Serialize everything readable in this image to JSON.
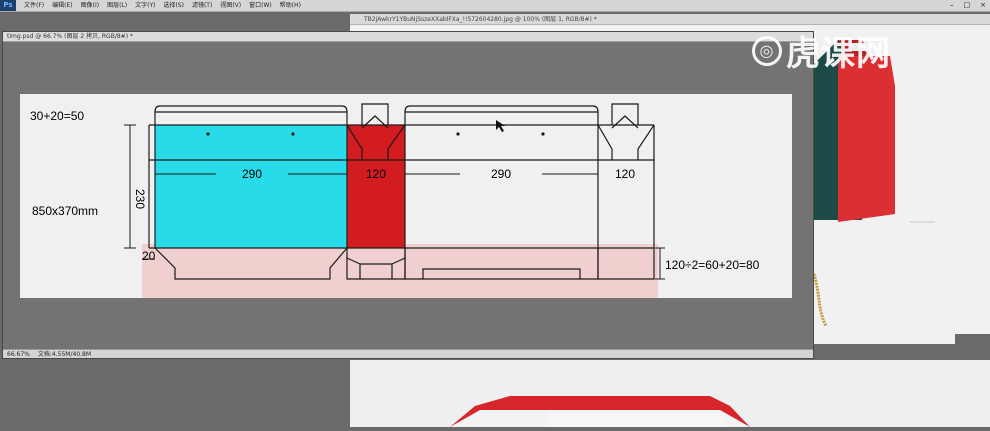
{
  "app": {
    "logo": "Ps",
    "menus": [
      "文件(F)",
      "编辑(E)",
      "图像(I)",
      "图层(L)",
      "文字(Y)",
      "选择(S)",
      "滤镜(T)",
      "视图(V)",
      "窗口(W)",
      "帮助(H)"
    ],
    "window_controls": [
      "–",
      "□",
      "×"
    ]
  },
  "bg_window": {
    "title": "TB2jAwkrY1YBuNjSszeXXablFXa_!!572604280.jpg @ 100% (图层 1, RGB/8#) *"
  },
  "doc_window": {
    "title": "timg.psd @ 66.7% (图层 2 拷贝, RGB/8#) *",
    "zoom": "66.67%",
    "doc_size": "文档:4.55M/40.8M"
  },
  "watermark": {
    "icon": "tiger-logo-icon",
    "text": "虎课网"
  },
  "dieline": {
    "label_top": "30+20=50",
    "label_height": "230",
    "label_size": "850x370mm",
    "label_bottom": "20",
    "label_right": "120÷2=60+20=80",
    "panel_widths": [
      "290",
      "120",
      "290",
      "120"
    ],
    "colors": {
      "cyan": "#29dbe9",
      "red": "#d31c1f",
      "pink": "#f0cfcf",
      "line": "#1a1a1a"
    }
  }
}
